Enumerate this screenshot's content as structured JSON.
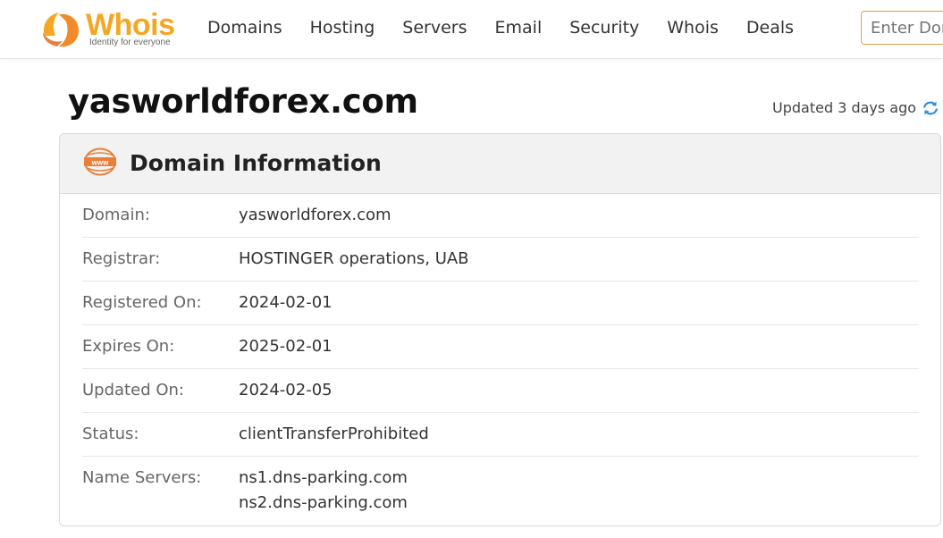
{
  "header": {
    "logo_word": "Whois",
    "logo_tagline": "Identity for everyone",
    "nav": [
      "Domains",
      "Hosting",
      "Servers",
      "Email",
      "Security",
      "Whois",
      "Deals"
    ],
    "search_placeholder": "Enter Domain or IP"
  },
  "page": {
    "title": "yasworldforex.com",
    "updated": "Updated 3 days ago"
  },
  "card": {
    "title": "Domain Information",
    "rows": [
      {
        "label": "Domain:",
        "value": "yasworldforex.com"
      },
      {
        "label": "Registrar:",
        "value": "HOSTINGER operations, UAB"
      },
      {
        "label": "Registered On:",
        "value": "2024-02-01"
      },
      {
        "label": "Expires On:",
        "value": "2025-02-01"
      },
      {
        "label": "Updated On:",
        "value": "2024-02-05"
      },
      {
        "label": "Status:",
        "value": "clientTransferProhibited"
      },
      {
        "label": "Name Servers:",
        "values": [
          "ns1.dns-parking.com",
          "ns2.dns-parking.com"
        ]
      }
    ]
  },
  "colors": {
    "brand_orange": "#f5a623",
    "icon_orange": "#e8803a",
    "refresh_blue": "#2a8fd8"
  },
  "icons": {
    "logo": "whois-logo-icon",
    "card": "www-globe-icon",
    "refresh": "refresh-icon"
  }
}
